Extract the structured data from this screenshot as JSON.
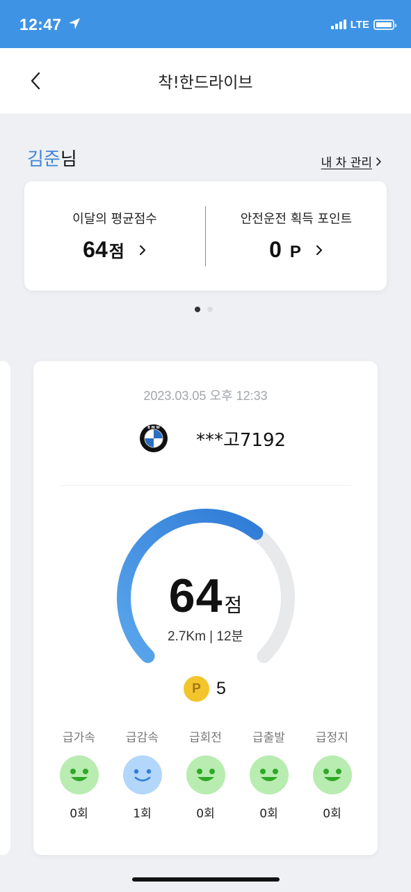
{
  "status_bar": {
    "time": "12:47",
    "network": "LTE",
    "background_color": "#3f93e4"
  },
  "nav": {
    "title": "착!한드라이브",
    "back_icon": "chevron-left-icon"
  },
  "greeting": {
    "name": "김준",
    "honorific": "님",
    "name_color": "#3d84d8"
  },
  "my_car_link": {
    "label": "내 차 관리",
    "icon": "chevron-right-icon"
  },
  "summary": {
    "monthly_avg": {
      "label": "이달의 평균점수",
      "value": "64",
      "unit": "점"
    },
    "safe_points": {
      "label": "안전운전 획득 포인트",
      "value": "0",
      "unit": "P"
    },
    "pager": {
      "active": 1,
      "total": 2
    }
  },
  "drive": {
    "datetime": "2023.03.05 오후 12:33",
    "car_brand_icon": "bmw-logo-icon",
    "plate": "***고7192",
    "score": "64",
    "score_unit": "점",
    "score_fraction": 0.64,
    "distance_time": "2.7Km | 12분",
    "point_badge": "P",
    "points": "5",
    "gauge_color": "#3d84d8",
    "gauge_track_color": "#e8e9eb",
    "events": [
      {
        "label": "급가속",
        "count": "0회",
        "face": "green-smile-icon"
      },
      {
        "label": "급감속",
        "count": "1회",
        "face": "blue-smile-icon"
      },
      {
        "label": "급회전",
        "count": "0회",
        "face": "green-smile-icon"
      },
      {
        "label": "급출발",
        "count": "0회",
        "face": "green-smile-icon"
      },
      {
        "label": "급정지",
        "count": "0회",
        "face": "green-smile-icon"
      }
    ]
  }
}
